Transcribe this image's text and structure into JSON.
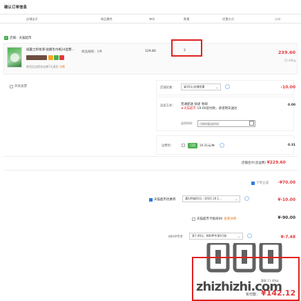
{
  "title": "确认订单信息",
  "columns": [
    "店铺宝贝",
    "商品属性",
    "单价",
    "数量",
    "优惠方式",
    "小计"
  ],
  "store": {
    "name": "店铺：天猫超市"
  },
  "item": {
    "name": "威露士卸妆液·贴膜毛巾瓶24盒整...",
    "spec": "商品规格：1件",
    "price": "129.80",
    "qty": "2",
    "subtotal": "239.60",
    "weight": "11.46kg",
    "note_prefix": "收货后自提本店铺7天退货",
    "note_tag": "详情"
  },
  "invoice": {
    "label": "开具发票"
  },
  "store_coupon": {
    "label": "店铺优惠：",
    "value": "省10元:店铺优惠",
    "amount": "-10.00"
  },
  "shipping": {
    "label": "运送方式：",
    "line1": "普通配送 快递 免邮",
    "line2_red": "★天猫超市",
    "line2": "19:00前付款，承诺明天送达",
    "time_label": "送货时间：",
    "time_value": "可按时配送时间",
    "amount": "0.00"
  },
  "points": {
    "label": "运费险：",
    "badge": "可用",
    "text": "10.31元/单",
    "amount": "0.31"
  },
  "store_total": {
    "label": "店铺合计(含运费)",
    "value": "¥229.60"
  },
  "discounts": [
    {
      "label": "下单立减",
      "amount": "-¥70.00"
    },
    {
      "label": "天猫超市优惠券",
      "select": "满149减10元（2021.10.1...",
      "amount": "¥-10.00"
    },
    {
      "label": "天猫超市卡抵扣90",
      "tag": "查看详情",
      "amount": "¥-90.00"
    },
    {
      "label": "88VIP专享",
      "select": "享7.49元：88VIP专享9.5折",
      "amount": "¥-7.48"
    }
  ],
  "watermark": "zhizhizhi.com",
  "final": {
    "weight_label": "重量",
    "weight": "11.46kg",
    "total_label": "实付款：",
    "total": "¥142.12"
  },
  "colors": {
    "accent": "#e4393c",
    "highlight": "#e02020",
    "green": "#4caf50",
    "blue": "#2d7ae0"
  }
}
